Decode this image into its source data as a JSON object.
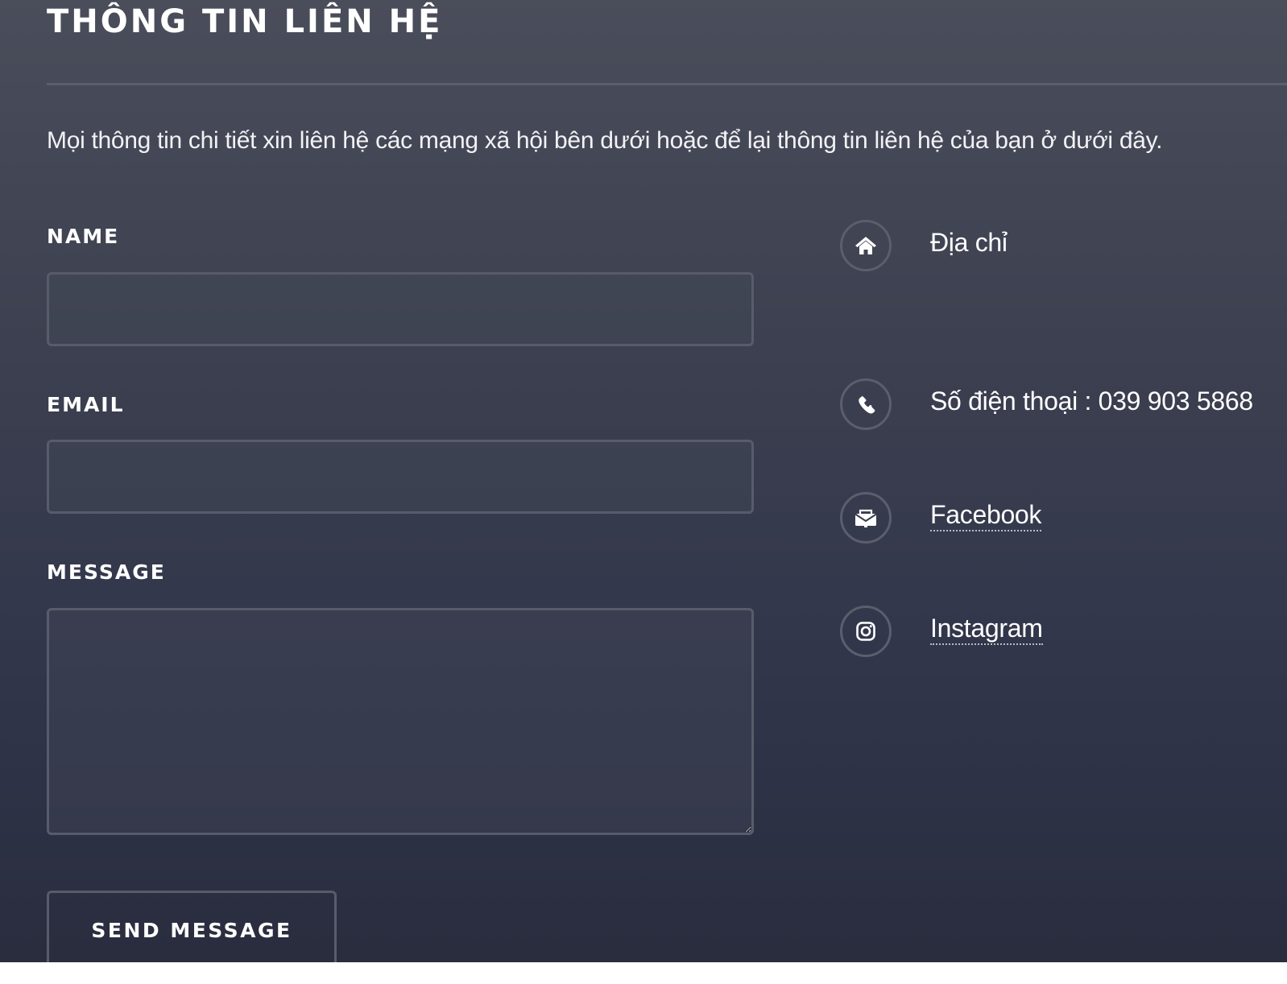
{
  "section": {
    "title": "THÔNG TIN LIÊN HỆ",
    "intro": "Mọi thông tin chi tiết xin liên hệ các mạng xã hội bên dưới hoặc để lại thông tin liên hệ của bạn ở dưới đây."
  },
  "form": {
    "name_label": "NAME",
    "name_value": "",
    "email_label": "EMAIL",
    "email_value": "",
    "message_label": "MESSAGE",
    "message_value": "",
    "submit_label": "SEND MESSAGE"
  },
  "contacts": [
    {
      "icon": "home-icon",
      "text": "Địa chỉ"
    },
    {
      "icon": "phone-icon",
      "text": "Số điện thoại : 039 903 5868"
    },
    {
      "icon": "mail-icon",
      "text": "Facebook"
    },
    {
      "icon": "instagram-icon",
      "text": "Instagram"
    }
  ],
  "colors": {
    "background_top": "#4a4d5a",
    "background_bottom": "#282c3d",
    "border": "#585c6a",
    "text": "#ffffff"
  }
}
